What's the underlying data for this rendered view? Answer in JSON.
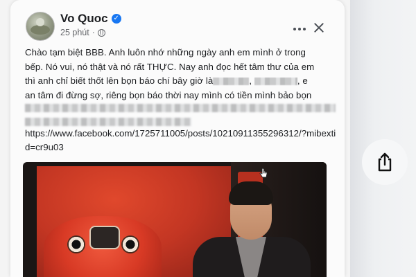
{
  "post": {
    "author": "Vo Quoc",
    "verified": true,
    "time": "25 phút",
    "privacy_icon": "globe-icon",
    "text_lines": [
      "Chào tạm biệt BBB. Anh luôn nhớ những ngày anh em mình ở trong",
      "bếp. Nó vui, nó thật và nó rất THỰC. Nay anh đọc hết tâm thư của em",
      "thì anh chỉ biết thốt lên bọn báo chí bây giờ là",
      "an tâm đi đừng sợ, riêng bọn báo thời nay mình có tiền mình bảo bọn"
    ],
    "line3_sep": ",",
    "line3_tail": ", e",
    "link": "https://www.facebook.com/1725711005/posts/10210911355296312/?mibextid=cr9u03"
  },
  "icons": {
    "more": "more-options-icon",
    "close": "close-icon",
    "share": "share-icon",
    "cursor": "hand-cursor-icon"
  },
  "colors": {
    "verified": "#1877f2",
    "text": "#1c1e21",
    "secondary": "#65676b"
  }
}
